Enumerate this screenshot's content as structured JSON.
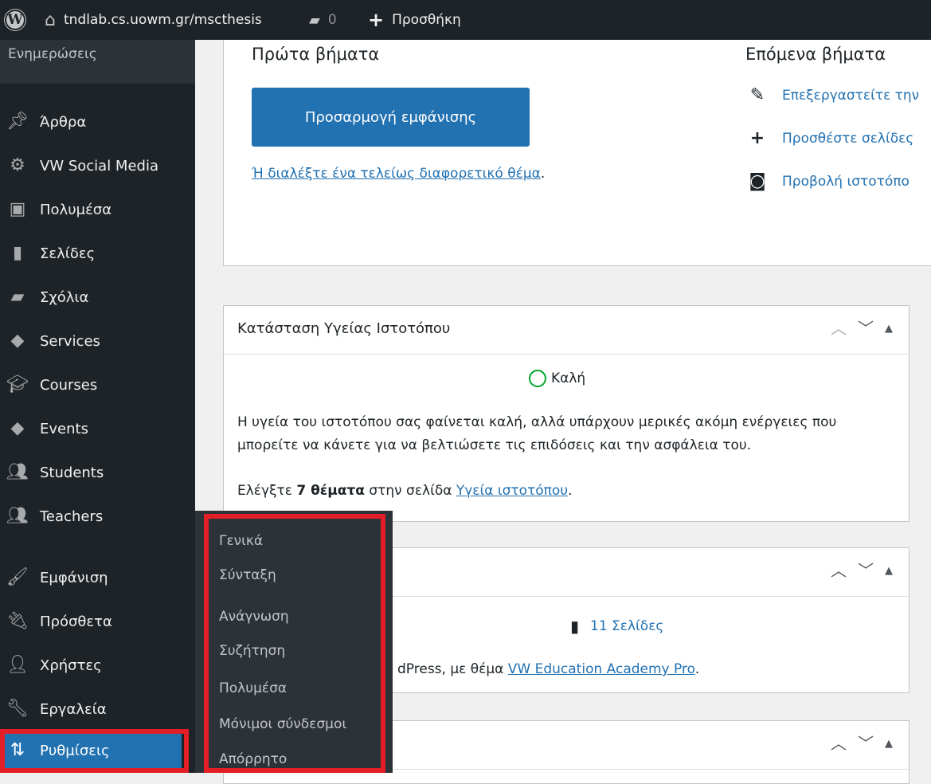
{
  "admin_bar": {
    "site_url": "tndlab.cs.uowm.gr/mscthesis",
    "comments_count": "0",
    "new_label": "Προσθήκη"
  },
  "sidebar": {
    "updates_label": "Ενημερώσεις",
    "items": [
      {
        "label": "Άρθρα",
        "icon": "pin-icon"
      },
      {
        "label": "VW Social Media",
        "icon": "gear-icon"
      },
      {
        "label": "Πολυμέσα",
        "icon": "media-icon"
      },
      {
        "label": "Σελίδες",
        "icon": "pages-icon"
      },
      {
        "label": "Σχόλια",
        "icon": "comment-icon"
      },
      {
        "label": "Services",
        "icon": "tag-icon"
      },
      {
        "label": "Courses",
        "icon": "mortarboard-icon"
      },
      {
        "label": "Events",
        "icon": "tag-icon"
      },
      {
        "label": "Students",
        "icon": "users-icon"
      },
      {
        "label": "Teachers",
        "icon": "users-icon"
      },
      {
        "label": "Εμφάνιση",
        "icon": "brush-icon"
      },
      {
        "label": "Πρόσθετα",
        "icon": "plugin-icon"
      },
      {
        "label": "Χρήστες",
        "icon": "user-icon"
      },
      {
        "label": "Εργαλεία",
        "icon": "wrench-icon"
      },
      {
        "label": "Ρυθμίσεις",
        "icon": "settings-icon"
      }
    ]
  },
  "settings_submenu": [
    "Γενικά",
    "Σύνταξη",
    "Ανάγνωση",
    "Συζήτηση",
    "Πολυμέσα",
    "Μόνιμοι σύνδεσμοι",
    "Απόρρητο"
  ],
  "welcome": {
    "first_steps_title": "Πρώτα βήματα",
    "customize_button": "Προσαρμογή εμφάνισης",
    "choose_theme_link": "Ή διαλέξτε ένα τελείως διαφορετικό θέμα",
    "choose_theme_suffix": ".",
    "next_steps_title": "Επόμενα βήματα",
    "next_steps": [
      {
        "label": "Επεξεργαστείτε την",
        "icon": "edit-icon"
      },
      {
        "label": "Προσθέστε σελίδες",
        "icon": "plus-icon"
      },
      {
        "label": "Προβολή ιστοτόπο",
        "icon": "view-site-icon"
      }
    ]
  },
  "site_health": {
    "title": "Κατάσταση Υγείας Ιστοτόπου",
    "status": "Καλή",
    "description": "Η υγεία του ιστοτόπου σας φαίνεται καλή, αλλά υπάρχουν μερικές ακόμη ενέργειες που μπορείτε να κάνετε για να βελτιώσετε τις επιδόσεις και την ασφάλεια του.",
    "items_prefix": "Ελέγξτε ",
    "items_count": "7 θέματα",
    "items_middle": " στην σελίδα ",
    "items_link": "Υγεία ιστοτόπου",
    "items_suffix": "."
  },
  "at_a_glance": {
    "pages_link": "11 Σελίδες",
    "theme_prefix": "dPress, με θέμα ",
    "theme_link": "VW Education Academy Pro",
    "theme_suffix": "."
  },
  "colors": {
    "accent": "#2271b1",
    "admin_bg": "#1d2327",
    "highlight_box": "#e41e26",
    "health_good": "#00a32a"
  }
}
